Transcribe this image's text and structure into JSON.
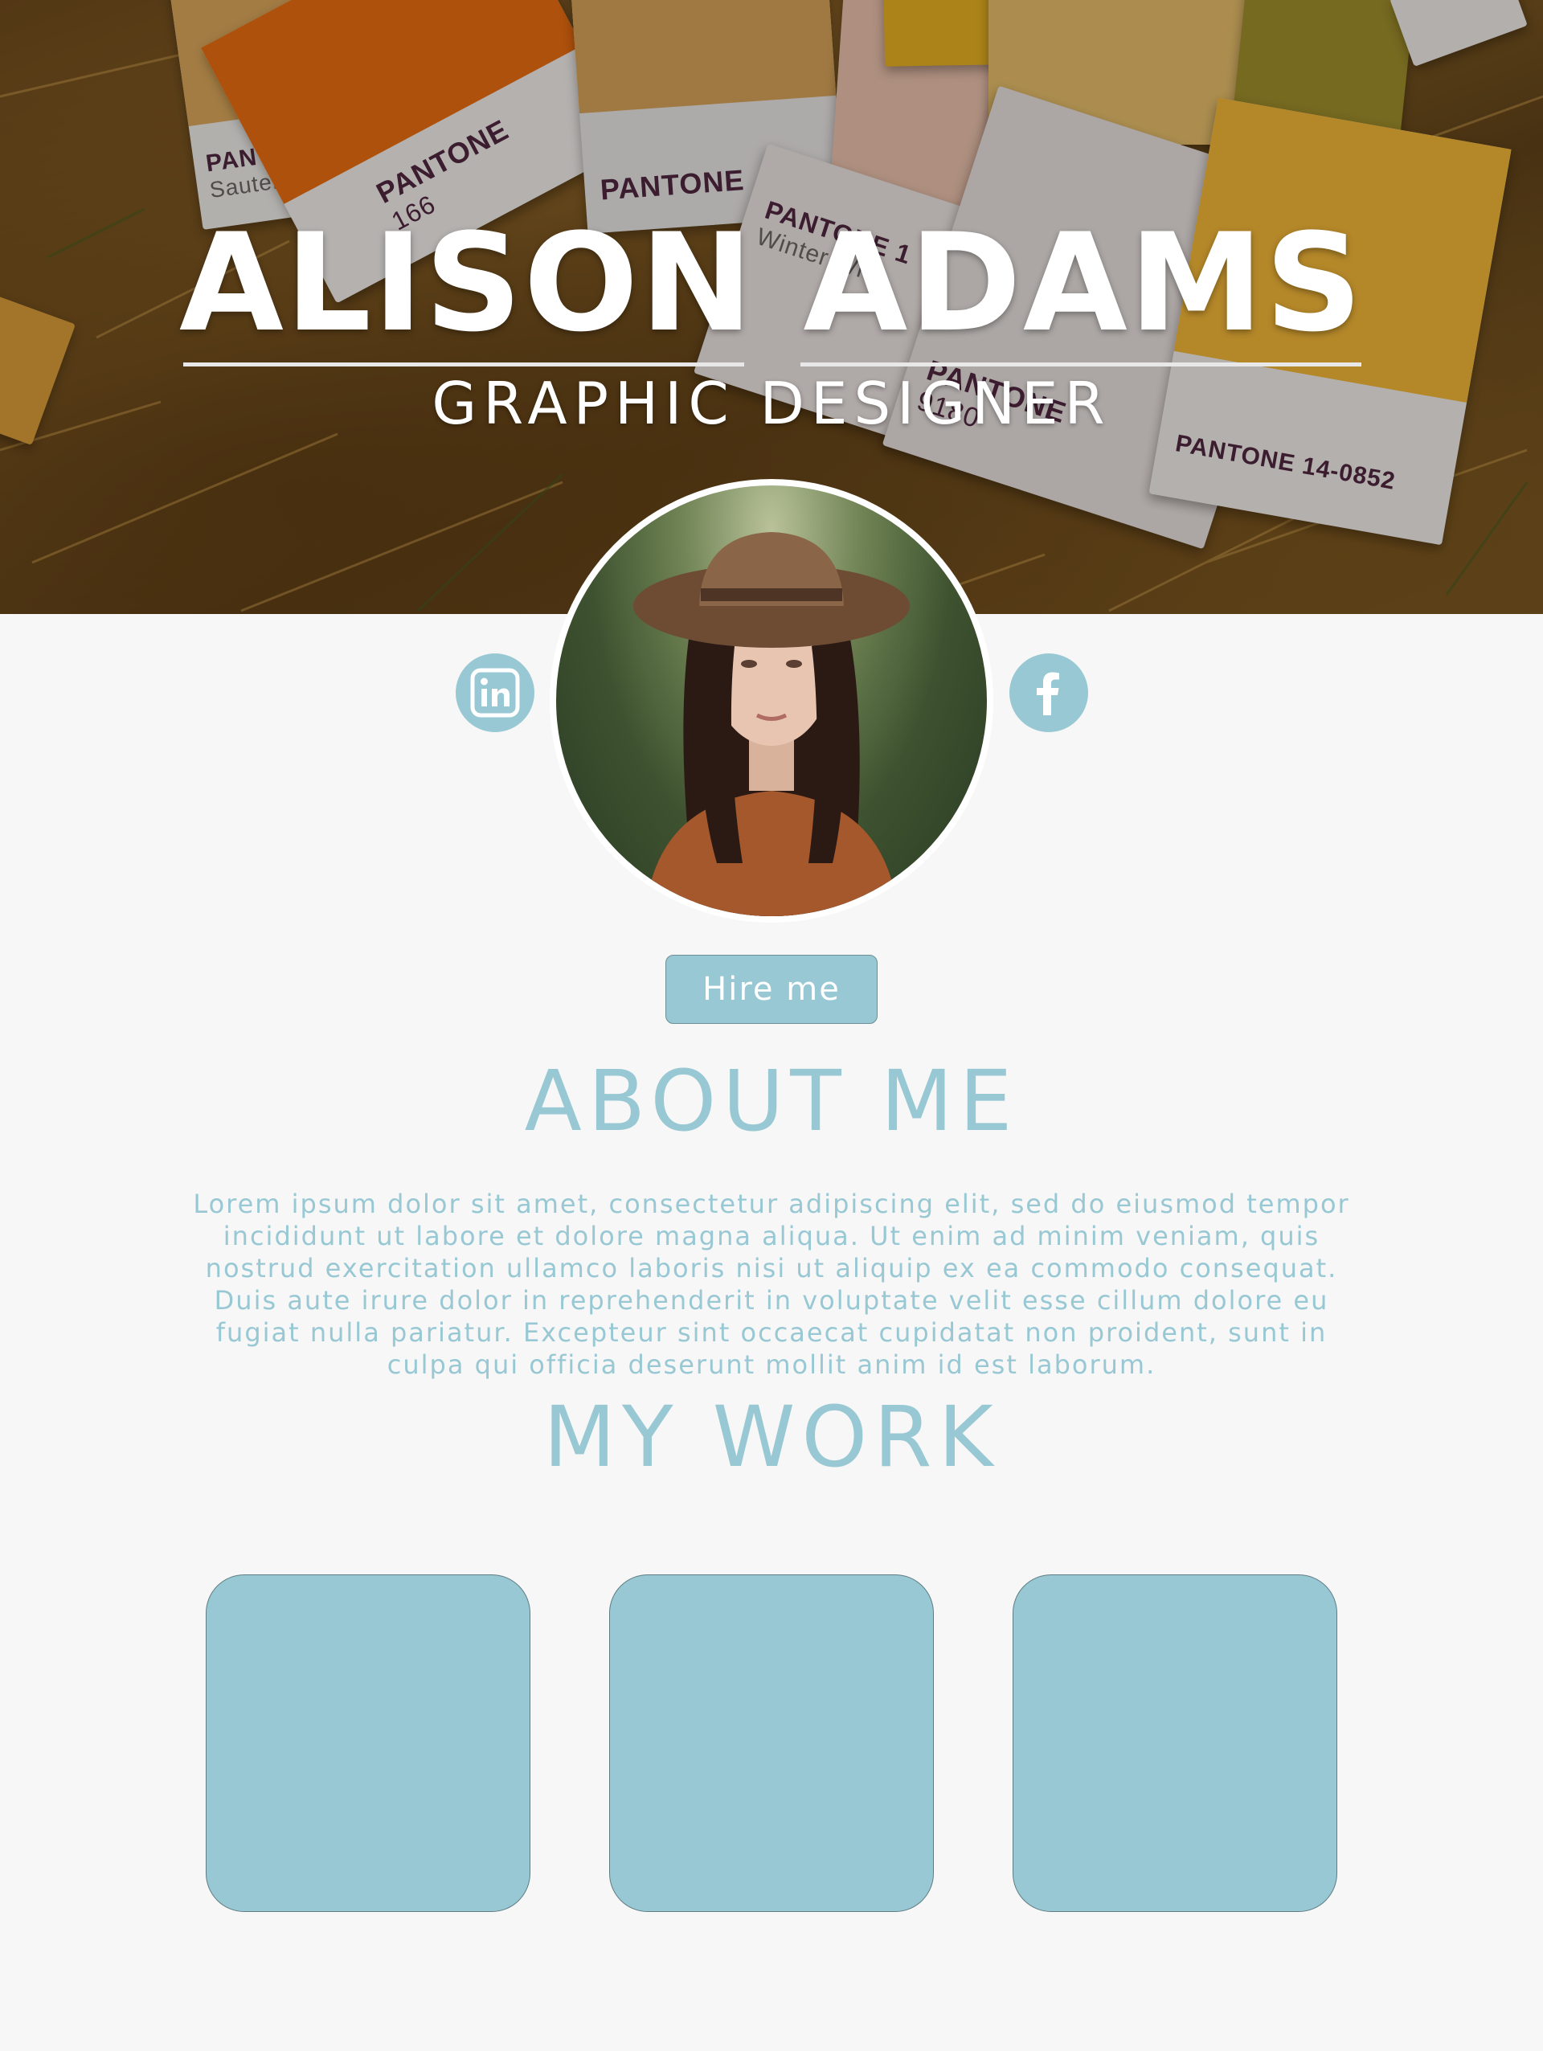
{
  "hero": {
    "name": "ALISON ADAMS",
    "title": "GRAPHIC DESIGNER",
    "swatch_labels": [
      {
        "text": "PANTONE",
        "sub": "Sauterne"
      },
      {
        "text": "PANTONE",
        "sub": "166"
      },
      {
        "text": "PANTONE",
        "sub": ""
      },
      {
        "text": "PANTONE 1",
        "sub": "Winter Wh"
      },
      {
        "text": "PANTONE",
        "sub": "9180"
      },
      {
        "text": "PANTONE 14-0852",
        "sub": ""
      }
    ]
  },
  "profile": {
    "avatar_icon": "portrait-photo"
  },
  "social": {
    "linkedin_icon": "linkedin-icon",
    "linkedin_glyph": "in",
    "facebook_icon": "facebook-icon",
    "facebook_glyph": "f"
  },
  "actions": {
    "hire_label": "Hire me"
  },
  "about": {
    "title": "ABOUT ME",
    "lines": [
      "Lorem ipsum dolor sit amet, consectetur adipiscing elit, sed do eiusmod tempor",
      "incididunt ut labore et dolore magna aliqua. Ut enim ad minim veniam, quis",
      "nostrud exercitation ullamco laboris nisi ut aliquip ex ea commodo consequat.",
      "Duis aute irure dolor in reprehenderit in voluptate velit esse cillum dolore eu",
      "fugiat nulla pariatur. Excepteur sint occaecat cupidatat non proident, sunt in",
      "culpa qui officia deserunt mollit anim id est laborum."
    ]
  },
  "work": {
    "title": "MY WORK",
    "tiles": [
      "",
      "",
      ""
    ]
  },
  "colors": {
    "accent": "#98c8d3",
    "background": "#f7f7f7",
    "text_light": "#ffffff"
  }
}
